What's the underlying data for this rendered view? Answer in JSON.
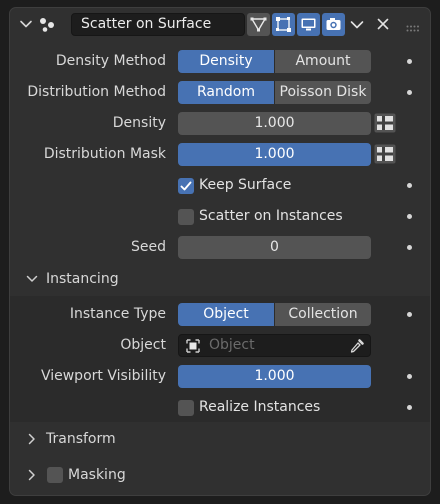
{
  "header": {
    "modifier_name": "Scatter on Surface",
    "icons": [
      "expand-chevron-icon",
      "geometry-nodes-icon",
      "edit-mode-icon",
      "cage-icon",
      "realtime-icon",
      "render-icon",
      "dropdown-chevron-icon",
      "close-icon",
      "drag-handle-icon"
    ]
  },
  "density_method": {
    "label": "Density Method",
    "options": [
      "Density",
      "Amount"
    ],
    "selected": "Density"
  },
  "distribution_method": {
    "label": "Distribution Method",
    "options": [
      "Random",
      "Poisson Disk"
    ],
    "selected": "Random"
  },
  "density": {
    "label": "Density",
    "value": "1.000"
  },
  "distribution_mask": {
    "label": "Distribution Mask",
    "value": "1.000",
    "fill": 1.0
  },
  "keep_surface": {
    "label": "Keep Surface",
    "checked": true
  },
  "scatter_on_instances": {
    "label": "Scatter on Instances",
    "checked": false
  },
  "seed": {
    "label": "Seed",
    "value": "0"
  },
  "instancing": {
    "title": "Instancing",
    "expanded": true,
    "instance_type": {
      "label": "Instance Type",
      "options": [
        "Object",
        "Collection"
      ],
      "selected": "Object"
    },
    "object": {
      "label": "Object",
      "placeholder": "Object"
    },
    "viewport_visibility": {
      "label": "Viewport Visibility",
      "value": "1.000",
      "fill": 1.0
    },
    "realize_instances": {
      "label": "Realize Instances",
      "checked": false
    }
  },
  "transform": {
    "title": "Transform",
    "expanded": false
  },
  "masking": {
    "title": "Masking",
    "expanded": false,
    "enabled": false
  },
  "colors": {
    "accent": "#4772b3",
    "panel": "#303030",
    "button": "#545454",
    "field": "#1d1d1d"
  }
}
